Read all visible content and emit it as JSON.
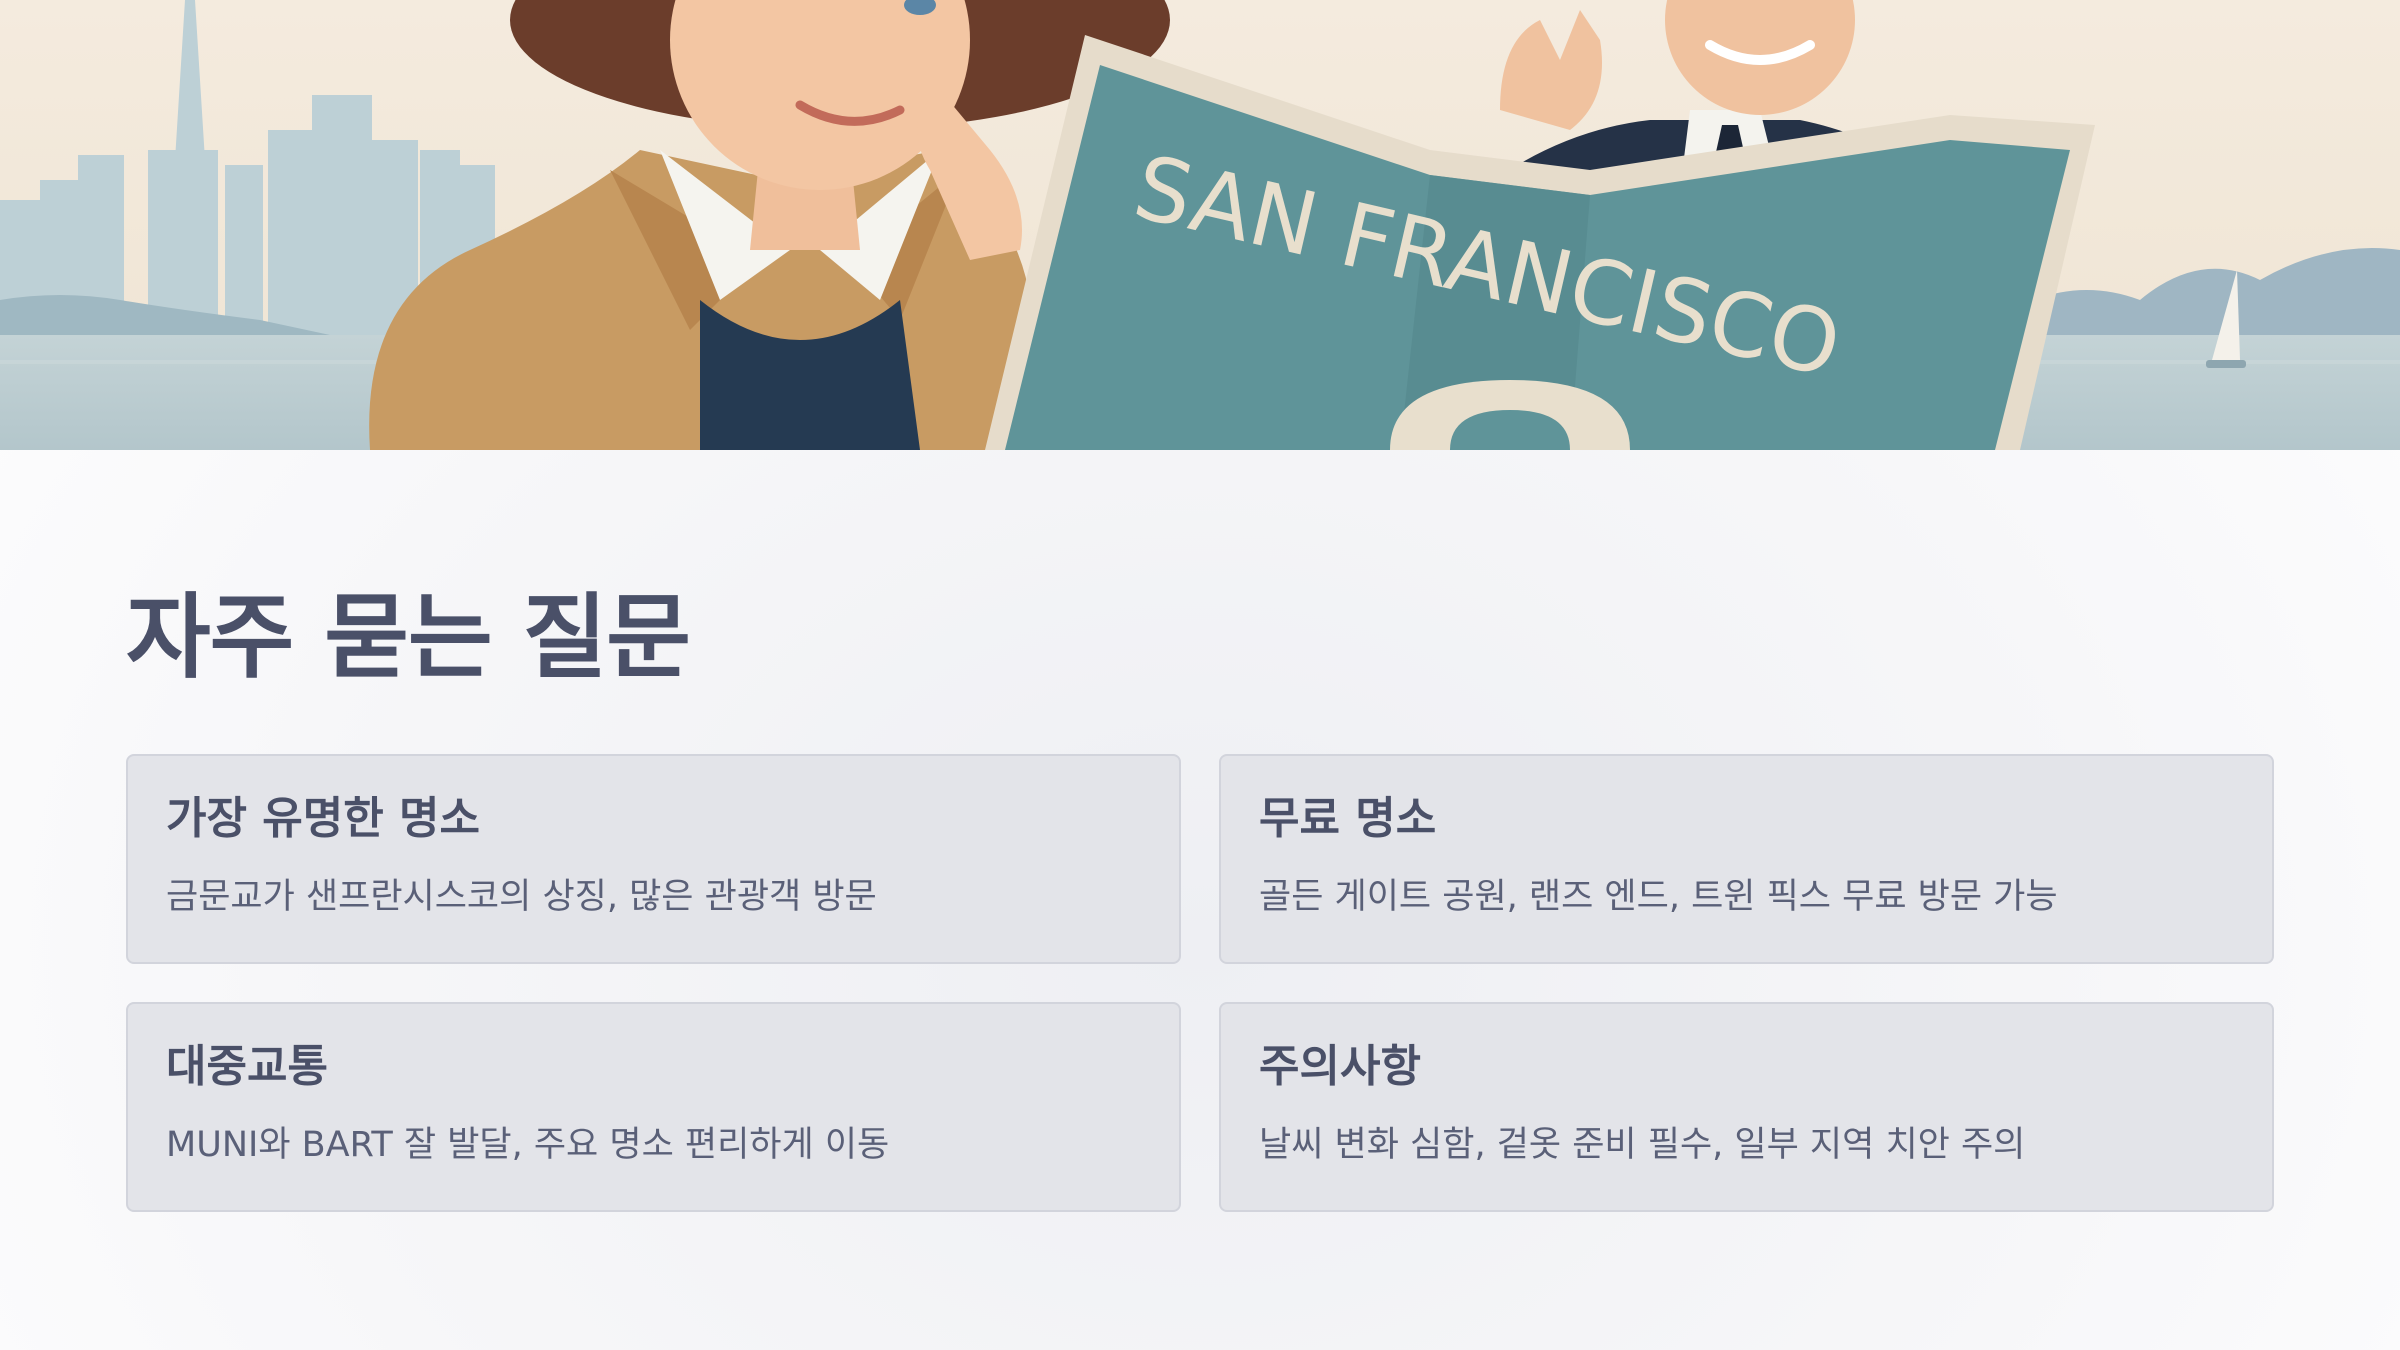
{
  "hero": {
    "map_title": "SAN FRANCISCO",
    "map_marker_icon": "location-pin-icon",
    "colors": {
      "sky": "#f3e8da",
      "skyline": "#b9ccd3",
      "map": "#5f9499",
      "coat": "#c79a63",
      "suit": "#27344a"
    }
  },
  "faq": {
    "title": "자주 묻는 질문",
    "items": [
      {
        "question": "가장 유명한 명소",
        "answer": "금문교가 샌프란시스코의 상징, 많은 관광객 방문"
      },
      {
        "question": "무료 명소",
        "answer": "골든 게이트 공원, 랜즈 엔드, 트윈 픽스 무료 방문 가능"
      },
      {
        "question": "대중교통",
        "answer": "MUNI와 BART 잘 발달, 주요 명소 편리하게 이동"
      },
      {
        "question": "주의사항",
        "answer": "날씨 변화 심함, 겉옷 준비 필수, 일부 지역 치안 주의"
      }
    ],
    "colors": {
      "card_background": "#e3e4e9",
      "card_border": "#d2d4dc",
      "heading": "#4a5068",
      "body_text": "#5a6078"
    }
  }
}
